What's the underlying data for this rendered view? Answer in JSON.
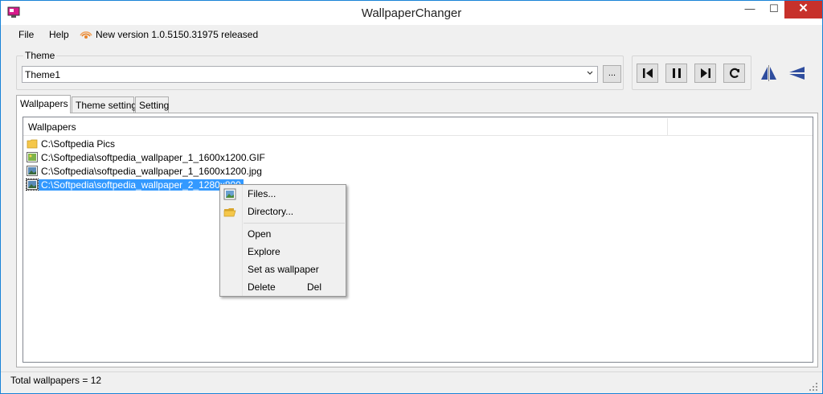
{
  "window": {
    "title": "WallpaperChanger",
    "controls": {
      "minimize": "—",
      "maximize": "☐",
      "close": "✕"
    }
  },
  "menu": {
    "file": "File",
    "help": "Help",
    "update_notice": "New version 1.0.5150.31975 released"
  },
  "theme": {
    "legend": "Theme",
    "selected": "Theme1",
    "browse_label": "..."
  },
  "player": {
    "buttons": [
      "previous",
      "pause",
      "next",
      "refresh"
    ]
  },
  "tabs": [
    {
      "label": "Wallpapers",
      "active": true
    },
    {
      "label": "Theme setting",
      "active": false
    },
    {
      "label": "Setting",
      "active": false
    }
  ],
  "list": {
    "column_header": "Wallpapers",
    "items": [
      {
        "icon": "folder-icon",
        "path": "C:\\Softpedia Pics"
      },
      {
        "icon": "image-gif-icon",
        "path": "C:\\Softpedia\\softpedia_wallpaper_1_1600x1200.GIF"
      },
      {
        "icon": "image-jpg-icon",
        "path": "C:\\Softpedia\\softpedia_wallpaper_1_1600x1200.jpg"
      },
      {
        "icon": "image-jpg-icon",
        "path": "C:\\Softpedia\\softpedia_wallpaper_2_1280x800",
        "selected": true
      }
    ]
  },
  "context_menu": {
    "files": "Files...",
    "directory": "Directory...",
    "open": "Open",
    "explore": "Explore",
    "set_wallpaper": "Set as wallpaper",
    "delete": "Delete",
    "delete_shortcut": "Del"
  },
  "status": {
    "text": "Total wallpapers = 12"
  },
  "colors": {
    "selection": "#3399ff",
    "close_button": "#c7312b",
    "window_border": "#1883d7"
  }
}
